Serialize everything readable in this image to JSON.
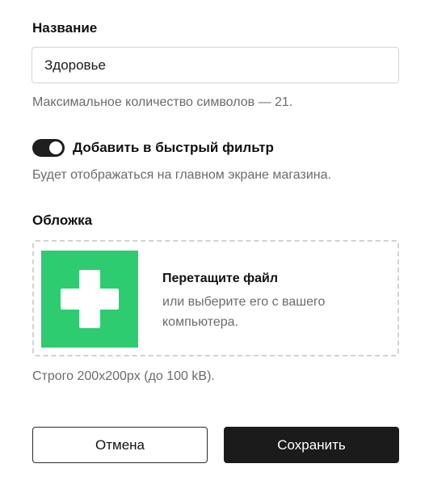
{
  "name_section": {
    "label": "Название",
    "input_value": "Здоровье",
    "hint": "Максимальное количество символов — 21."
  },
  "quick_filter": {
    "enabled": true,
    "label": "Добавить в быстрый фильтр",
    "hint": "Будет отображаться на главном экране магазина."
  },
  "cover_section": {
    "label": "Обложка",
    "dropzone_title": "Перетащите файл",
    "dropzone_subtitle": "или выберите его с вашего компьютера.",
    "thumbnail_color": "#2ecc71",
    "thumbnail_icon": "plus-icon",
    "hint": "Строго 200x200px (до 100 kB)."
  },
  "actions": {
    "cancel_label": "Отмена",
    "save_label": "Сохранить"
  }
}
